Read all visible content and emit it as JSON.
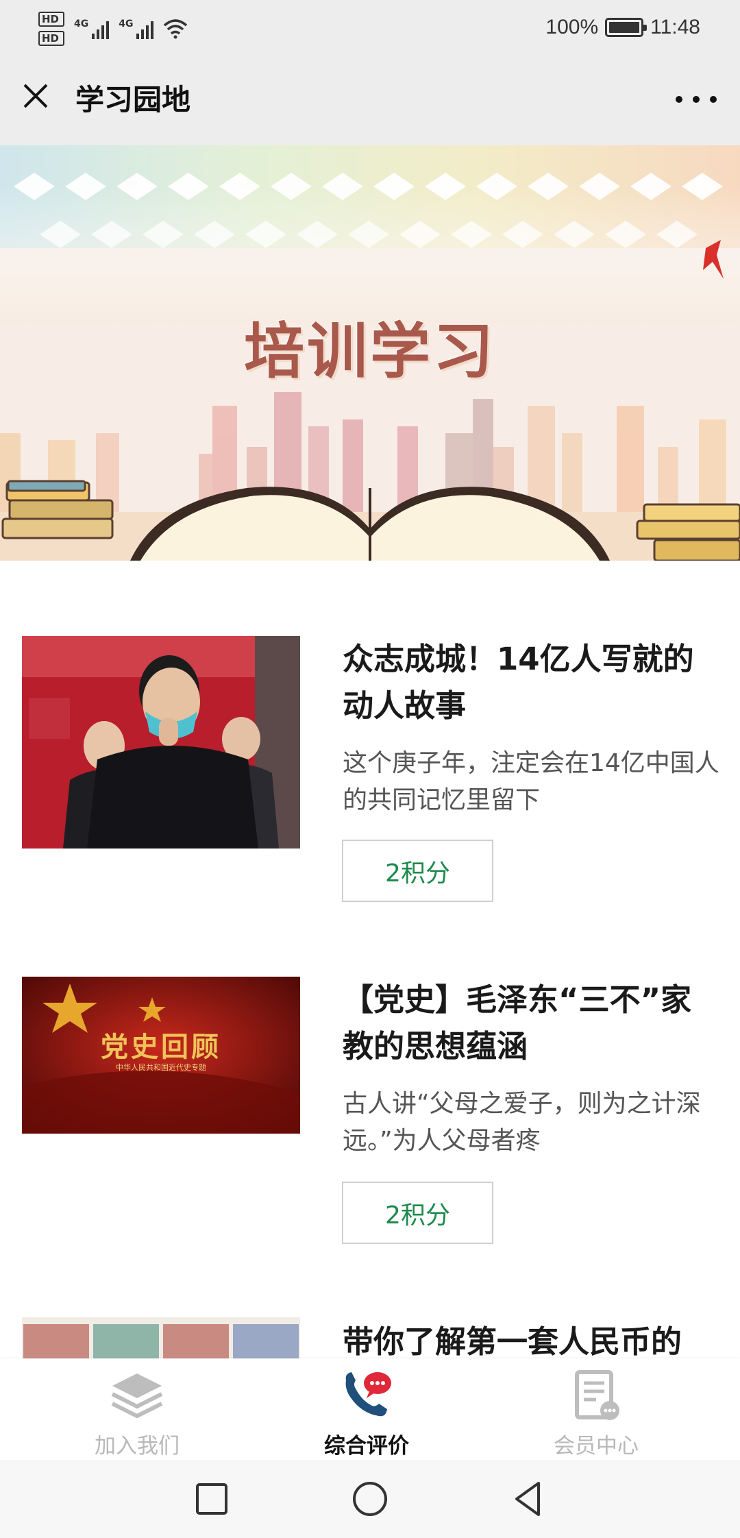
{
  "status_bar": {
    "hd1": "HD",
    "hd2": "HD",
    "net1": "4G",
    "net2": "4G",
    "battery": "100%",
    "time": "11:48"
  },
  "header": {
    "title": "学习园地"
  },
  "banner": {
    "title": "培训学习"
  },
  "articles": [
    {
      "title": "众志成城！14亿人写就的动人故事",
      "desc": "这个庚子年，注定会在14亿中国人的共同记忆里留下",
      "points": "2积分"
    },
    {
      "title": "【党史】毛泽东“三不”家教的思想蕴涵",
      "desc": "古人讲“父母之爱子，则为之计深远。”为人父母者疼",
      "points": "2积分",
      "thumb_text": "党史回顾",
      "thumb_sub": "中华人民共和国近代史专题"
    },
    {
      "title": "带你了解第一套人民币的"
    }
  ],
  "tabs": [
    {
      "label": "加入我们",
      "icon": "layers-icon"
    },
    {
      "label": "综合评价",
      "icon": "phone-chat-icon"
    },
    {
      "label": "会员中心",
      "icon": "document-icon"
    }
  ],
  "colors": {
    "points_text": "#1d8a4c",
    "banner_title": "#a8594b",
    "active_icon": "#1f4f7a",
    "badge": "#e0283a"
  }
}
